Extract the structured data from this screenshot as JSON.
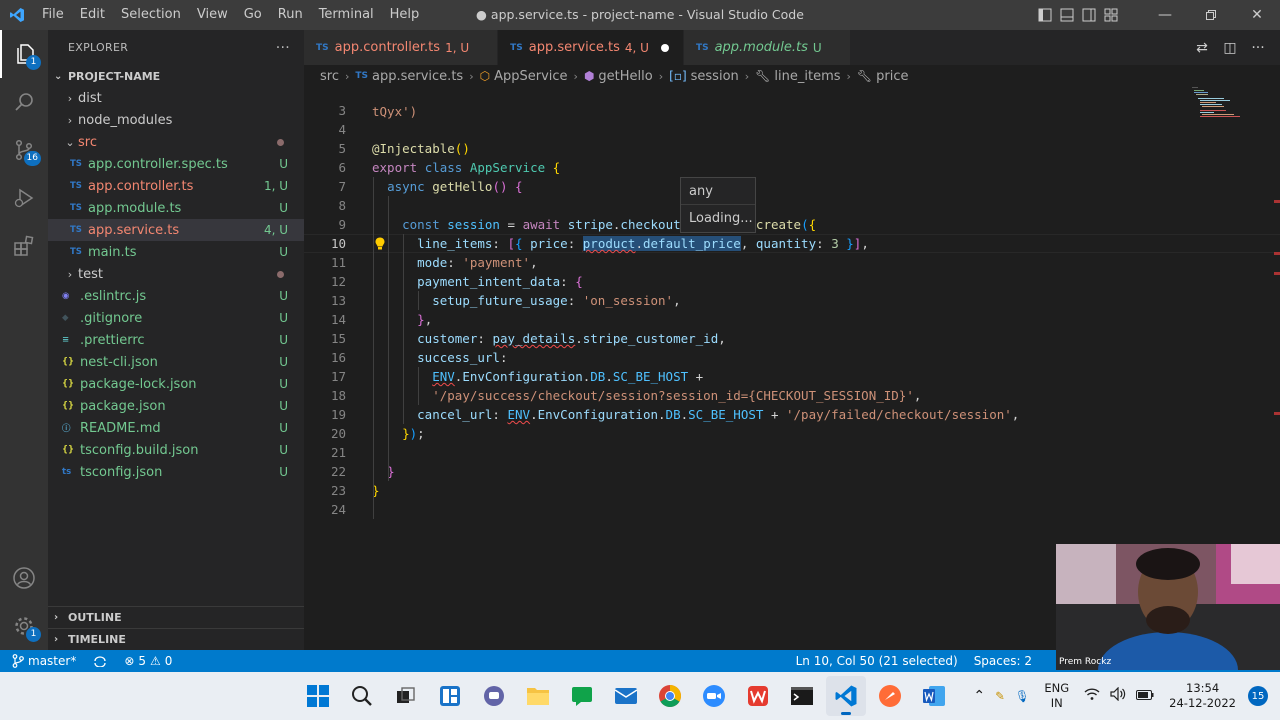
{
  "titlebar": {
    "menu": [
      "File",
      "Edit",
      "Selection",
      "View",
      "Go",
      "Run",
      "Terminal",
      "Help"
    ],
    "title": "● app.service.ts - project-name - Visual Studio Code"
  },
  "activity": {
    "explorer_badge": "1",
    "scm_badge": "16",
    "settings_badge": "1"
  },
  "sidebar": {
    "header": "EXPLORER",
    "more": "···",
    "project": "PROJECT-NAME",
    "items": [
      {
        "label": "dist",
        "type": "folder",
        "open": false,
        "indent": 1,
        "status": "",
        "color": "gray"
      },
      {
        "label": "node_modules",
        "type": "folder",
        "open": false,
        "indent": 1,
        "status": "",
        "color": "gray"
      },
      {
        "label": "src",
        "type": "folder",
        "open": true,
        "indent": 1,
        "status": "dot",
        "color": "red"
      },
      {
        "label": "app.controller.spec.ts",
        "type": "ts",
        "indent": 2,
        "status": "U",
        "color": "green"
      },
      {
        "label": "app.controller.ts",
        "type": "ts",
        "indent": 2,
        "status": "1, U",
        "color": "red"
      },
      {
        "label": "app.module.ts",
        "type": "ts",
        "indent": 2,
        "status": "U",
        "color": "green"
      },
      {
        "label": "app.service.ts",
        "type": "ts",
        "indent": 2,
        "status": "4, U",
        "color": "red",
        "selected": true
      },
      {
        "label": "main.ts",
        "type": "ts",
        "indent": 2,
        "status": "U",
        "color": "green"
      },
      {
        "label": "test",
        "type": "folder",
        "open": false,
        "indent": 1,
        "status": "dot",
        "color": "gray"
      },
      {
        "label": ".eslintrc.js",
        "type": "eslint",
        "indent": 1,
        "status": "U",
        "color": "green"
      },
      {
        "label": ".gitignore",
        "type": "git",
        "indent": 1,
        "status": "U",
        "color": "green"
      },
      {
        "label": ".prettierrc",
        "type": "prettier",
        "indent": 1,
        "status": "U",
        "color": "green"
      },
      {
        "label": "nest-cli.json",
        "type": "json",
        "indent": 1,
        "status": "U",
        "color": "green"
      },
      {
        "label": "package-lock.json",
        "type": "json",
        "indent": 1,
        "status": "U",
        "color": "green"
      },
      {
        "label": "package.json",
        "type": "json",
        "indent": 1,
        "status": "U",
        "color": "green"
      },
      {
        "label": "README.md",
        "type": "info",
        "indent": 1,
        "status": "U",
        "color": "green"
      },
      {
        "label": "tsconfig.build.json",
        "type": "json",
        "indent": 1,
        "status": "U",
        "color": "green"
      },
      {
        "label": "tsconfig.json",
        "type": "tsconfig",
        "indent": 1,
        "status": "U",
        "color": "green"
      }
    ],
    "outline": "OUTLINE",
    "timeline": "TIMELINE"
  },
  "tabs": [
    {
      "label": "app.controller.ts",
      "meta": "1, U",
      "style": "red",
      "active": false
    },
    {
      "label": "app.service.ts",
      "meta": "4, U",
      "style": "red",
      "active": true,
      "modified": true
    },
    {
      "label": "app.module.ts",
      "meta": "U",
      "style": "it",
      "active": false
    }
  ],
  "breadcrumb": {
    "parts": [
      "src",
      "app.service.ts",
      "AppService",
      "getHello",
      "session",
      "line_items",
      "price"
    ],
    "ts_badge": "TS"
  },
  "editor": {
    "partial_line": "tQyx')",
    "line_numbers": [
      "3",
      "4",
      "5",
      "6",
      "7",
      "8",
      "9",
      "10",
      "11",
      "12",
      "13",
      "14",
      "15",
      "16",
      "17",
      "18",
      "19",
      "20",
      "21",
      "22",
      "23",
      "24"
    ],
    "current_line": "10",
    "hover_type": "any",
    "hover_loading": "Loading..."
  },
  "webcam": {
    "name": "Prem Rockz"
  },
  "statusbar": {
    "branch": "master*",
    "errors": "5",
    "warnings": "0",
    "position": "Ln 10, Col 50 (21 selected)",
    "spaces": "Spaces: 2"
  },
  "taskbar": {
    "lang1": "ENG",
    "lang2": "IN",
    "time": "13:54",
    "date": "24-12-2022",
    "notifications": "15"
  }
}
